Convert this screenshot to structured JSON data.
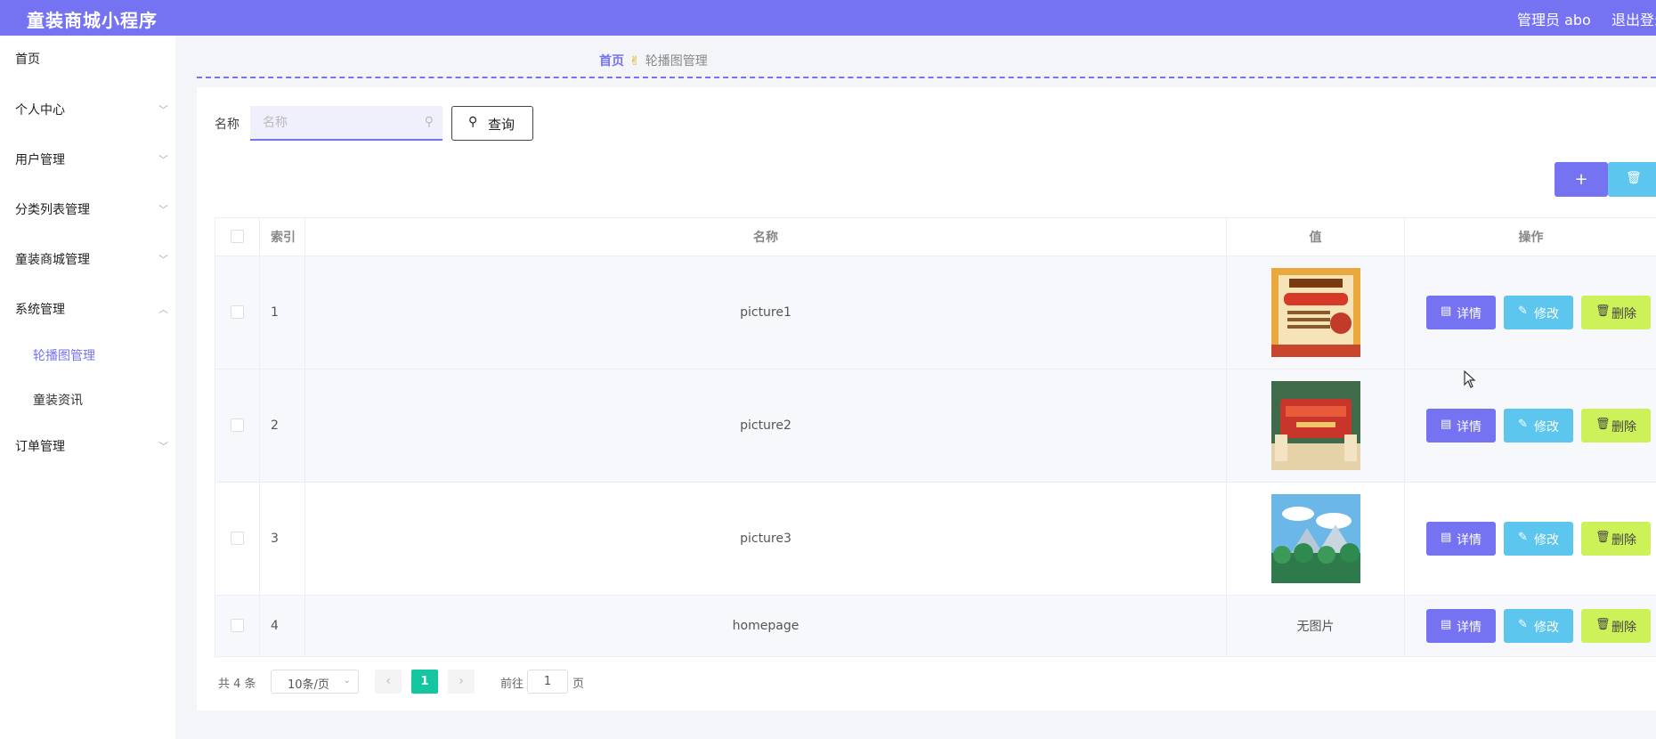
{
  "header": {
    "title": "童装商城小程序",
    "admin": "管理员 abo",
    "logout": "退出登录"
  },
  "sidebar": {
    "items": [
      {
        "label": "首页",
        "chevron": ""
      },
      {
        "label": "个人中心",
        "chevron": "﹀"
      },
      {
        "label": "用户管理",
        "chevron": "﹀"
      },
      {
        "label": "分类列表管理",
        "chevron": "﹀"
      },
      {
        "label": "童装商城管理",
        "chevron": "﹀"
      },
      {
        "label": "系统管理",
        "chevron": "︿"
      },
      {
        "label": "订单管理",
        "chevron": "﹀"
      }
    ],
    "subitems": [
      {
        "label": "轮播图管理",
        "active": true
      },
      {
        "label": "童装资讯",
        "active": false
      }
    ]
  },
  "breadcrumb": {
    "home": "首页",
    "current": "轮播图管理"
  },
  "search": {
    "label": "名称",
    "placeholder": "名称",
    "value": "",
    "button": "查询"
  },
  "toolbar": {
    "add": "+",
    "delete_icon": "trash-icon"
  },
  "table": {
    "headers": {
      "index": "索引",
      "name": "名称",
      "value": "值",
      "actions": "操作"
    },
    "rows": [
      {
        "index": "1",
        "name": "picture1",
        "value": "",
        "image": "festive-banner"
      },
      {
        "index": "2",
        "name": "picture2",
        "value": "",
        "image": "red-banner"
      },
      {
        "index": "3",
        "name": "picture3",
        "value": "",
        "image": "sky-forest"
      },
      {
        "index": "4",
        "name": "homepage",
        "value": "无图片",
        "image": ""
      }
    ],
    "actions": {
      "detail": "详情",
      "edit": "修改",
      "delete": "删除"
    }
  },
  "pagination": {
    "total": "共 4 条",
    "page_size": "10条/页",
    "current": "1",
    "goto_label": "前往",
    "goto_value": "1",
    "page_unit": "页"
  },
  "colors": {
    "primary": "#7573f2",
    "info": "#5cc6ef",
    "danger": "#cdf159",
    "active_page": "#14c7a0"
  }
}
